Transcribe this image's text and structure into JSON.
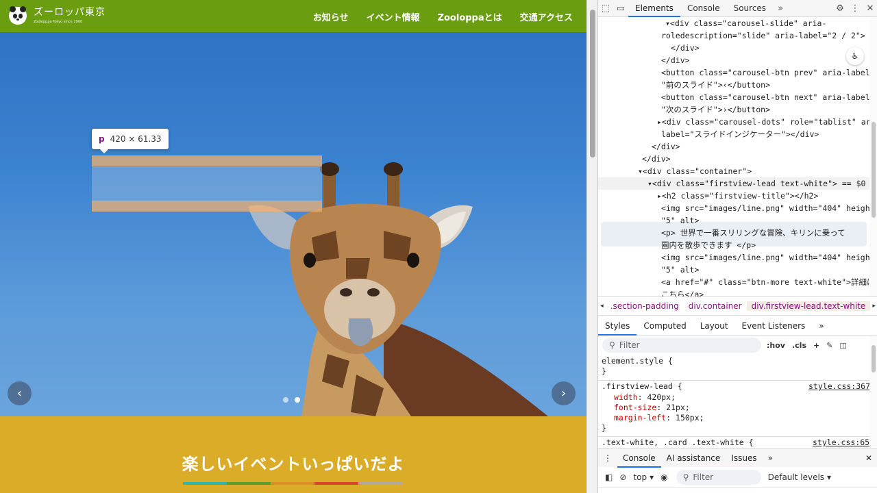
{
  "site": {
    "logo_main": "ズーロッパ東京",
    "logo_sub": "Zoolopppa Tokyo since 1960",
    "nav": [
      "お知らせ",
      "イベント情報",
      "Zooloppaとは",
      "交通アクセス"
    ],
    "events_title": "楽しいイベントいっぱいだよ",
    "carousel_prev": "‹",
    "carousel_next": "›",
    "brand_colors": [
      "#2fb5b0",
      "#5aa02c",
      "#dd8f25",
      "#d7452f",
      "#b2a8a0"
    ]
  },
  "inspector_tooltip": {
    "tag": "p",
    "size": "420 × 61.33"
  },
  "devtools": {
    "tabs": [
      "Elements",
      "Console",
      "Sources"
    ],
    "more": "»",
    "elements_lines": [
      {
        "code": "▾<div class=\"carousel-slide\" aria-",
        "indent": 98
      },
      {
        "code": "roledescription=\"slide\" aria-label=\"2 / 2\">",
        "indent": 106
      },
      {
        "code": "</div>",
        "indent": 106
      },
      {
        "code": "</div>",
        "indent": 92
      },
      {
        "code": "<button class=\"carousel-btn prev\" aria-label=",
        "indent": 92
      },
      {
        "code": "\"前のスライド\">‹</button>",
        "indent": 92
      },
      {
        "code": "<button class=\"carousel-btn next\" aria-label=",
        "indent": 92
      },
      {
        "code": "\"次のスライド\">›</button>",
        "indent": 92
      },
      {
        "code": "▸<div class=\"carousel-dots\" role=\"tablist\" aria-",
        "indent": 86
      },
      {
        "code": "label=\"スライドインジケーター\"></div>",
        "indent": 92
      },
      {
        "code": "</div>",
        "indent": 78
      },
      {
        "code": "</div>",
        "indent": 64
      },
      {
        "code": "▾<div class=\"container\">",
        "indent": 58
      },
      {
        "code": "▾<div class=\"firstview-lead text-white\"> == $0",
        "indent": 72
      },
      {
        "code": "▸<h2 class=\"firstview-title\"></h2>",
        "indent": 86
      },
      {
        "code": "<img src=\"images/line.png\" width=\"404\" height=",
        "indent": 92
      },
      {
        "code": "\"5\" alt>",
        "indent": 92
      },
      {
        "code": "<p> 世界で一番スリリングな冒険、キリンに乗って",
        "indent": 92
      },
      {
        "code": "園内を散歩できます </p>",
        "indent": 92
      },
      {
        "code": "<img src=\"images/line.png\" width=\"404\" height=",
        "indent": 92
      },
      {
        "code": "\"5\" alt>",
        "indent": 92
      },
      {
        "code": "<a href=\"#\" class=\"btn-more text-white\">詳細は",
        "indent": 92
      },
      {
        "code": "こちら</a>",
        "indent": 92
      }
    ],
    "breadcrumbs": [
      ".section-padding",
      "div.container",
      "div.firstview-lead.text-white"
    ],
    "styles_tabs": [
      "Styles",
      "Computed",
      "Layout",
      "Event Listeners"
    ],
    "filter_placeholder": "Filter",
    "filter_tools": [
      ":hov",
      ".cls",
      "+"
    ],
    "rules": {
      "element_style": "element.style {",
      "close": "}",
      "selector": ".firstview-lead {",
      "source": "style.css:367",
      "props": [
        {
          "name": "width",
          "value": "420px;"
        },
        {
          "name": "font-size",
          "value": "21px;"
        },
        {
          "name": "margin-left",
          "value": "150px;"
        }
      ],
      "next_selector": ".text-white, .card .text-white {",
      "next_source": "style.css:65"
    },
    "drawer_tabs": [
      "Console",
      "AI assistance",
      "Issues"
    ],
    "console_context": "top",
    "console_filter": "Filter",
    "console_levels": "Default levels"
  }
}
